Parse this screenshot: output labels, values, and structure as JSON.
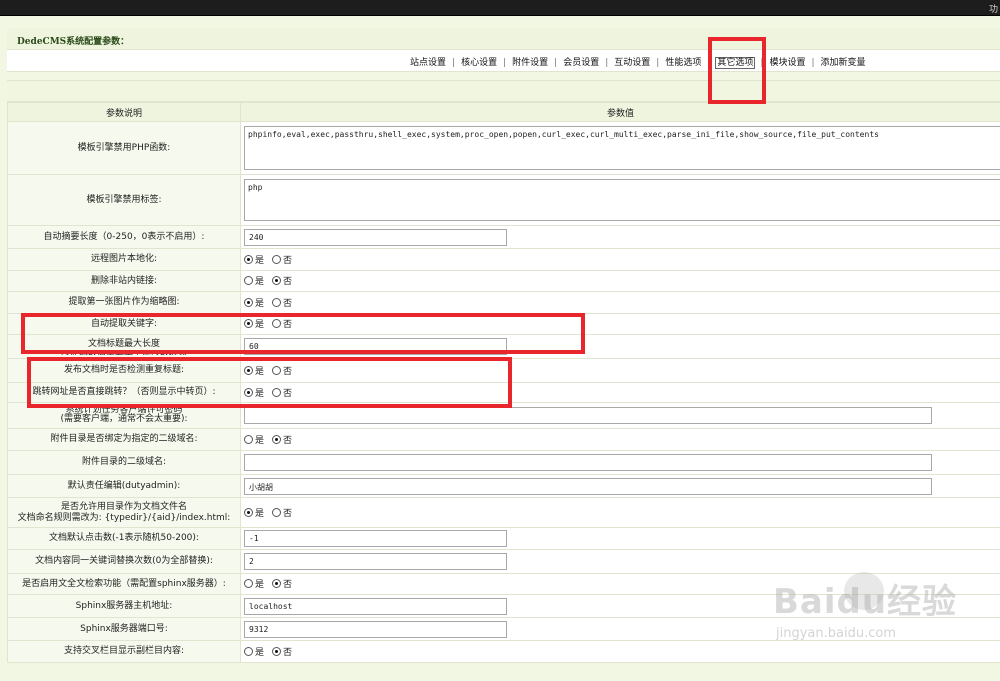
{
  "window": {
    "title": "DedeCMS系统配置参数：",
    "top_right_fragment": "功"
  },
  "tabs": [
    {
      "label": "站点设置",
      "active": false
    },
    {
      "label": "核心设置",
      "active": false
    },
    {
      "label": "附件设置",
      "active": false
    },
    {
      "label": "会员设置",
      "active": false
    },
    {
      "label": "互动设置",
      "active": false
    },
    {
      "label": "性能选项",
      "active": false
    },
    {
      "label": "其它选项",
      "active": true
    },
    {
      "label": "模块设置",
      "active": false
    },
    {
      "label": "添加新变量",
      "active": false
    }
  ],
  "table": {
    "headers": {
      "name": "参数说明",
      "value": "参数值"
    },
    "radio_labels": {
      "yes": "是",
      "no": "否"
    },
    "rows": {
      "disfunc": {
        "label": "模板引擎禁用PHP函数:",
        "value": "phpinfo,eval,exec,passthru,shell_exec,system,proc_open,popen,curl_exec,curl_multi_exec,parse_ini_file,show_source,file_put_contents"
      },
      "distag": {
        "label": "模板引擎禁用标签:",
        "value": "php"
      },
      "autodesc": {
        "label": "自动摘要长度（0-250，0表示不启用）:",
        "value": "240"
      },
      "remoteimg": {
        "label": "远程图片本地化:",
        "selected": "yes"
      },
      "dellink": {
        "label": "删除非站内链接:",
        "selected": "no"
      },
      "litpic": {
        "label": "提取第一张图片作为缩略图:",
        "selected": "yes"
      },
      "autokw": {
        "label": "自动提取关键字:",
        "selected": "yes"
      },
      "titlemax": {
        "label_line1": "文档标题最大长度",
        "label_line2": "改此参数后需要手工修改数据表",
        "value": "60"
      },
      "checktitle": {
        "label": "发布文档时是否检测重复标题:",
        "selected": "yes"
      },
      "jumpurl": {
        "label": "跳转网址是否直接跳转？（否则显示中转页）:",
        "selected": "yes"
      },
      "taskpwd": {
        "label_line1": "系统计划任务客户端许可密码",
        "label_line2": "(需要客户端，通常不会太重要):",
        "value": ""
      },
      "binddomain": {
        "label": "附件目录是否绑定为指定的二级域名:",
        "selected": "no"
      },
      "attdomain": {
        "label": "附件目录的二级域名:",
        "value": ""
      },
      "dutyadmin": {
        "label": "默认责任编辑(dutyadmin):",
        "value": "小胡胡"
      },
      "dirname": {
        "label_line1": "是否允许用目录作为文档文件名",
        "label_line2": "文档命名规则需改为: {typedir}/{aid}/index.html:",
        "selected": "yes"
      },
      "click": {
        "label": "文档默认点击数(-1表示随机50-200):",
        "value": "-1"
      },
      "kwreplace": {
        "label": "文档内容同一关键词替换次数(0为全部替换):",
        "value": "2"
      },
      "sphinx": {
        "label": "是否启用文全文检索功能（需配置sphinx服务器）:",
        "selected": "no"
      },
      "sphinxhost": {
        "label": "Sphinx服务器主机地址:",
        "value": "localhost"
      },
      "sphinxport": {
        "label": "Sphinx服务器端口号:",
        "value": "9312"
      },
      "crossshow": {
        "label": "支持交叉栏目显示副栏目内容:",
        "selected": "no"
      }
    }
  },
  "watermark": {
    "logo": "Baidu经验",
    "site": "jingyan.baidu.com"
  },
  "colors": {
    "annotation_red": "#e8262c",
    "panel_bg": "#f2f7e4",
    "topbar": "#1d1d1d"
  }
}
